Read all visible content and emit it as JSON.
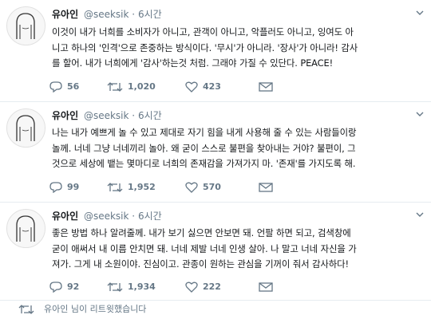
{
  "colors": {
    "text": "#14171a",
    "muted": "#657786",
    "divider": "#e6ecf0"
  },
  "tweets": [
    {
      "name": "유아인",
      "handle": "@seeksik",
      "dot": "·",
      "time": "6시간",
      "lines": [
        "이것이 내가 너희를 소비자가 아니고, 관객이 아니고, 악플러도 아니고, 잉여도 아",
        "니고 하나의 '인격'으로 존중하는 방식이다. '무시'가 아니라. '장사'가 아니라! 감사",
        "를 할어. 내가 너희에게 '감사'하는것 처럼. 그래야 가질 수 있단다. PEACE!"
      ],
      "replies": "56",
      "retweets": "1,020",
      "likes": "423"
    },
    {
      "name": "유아인",
      "handle": "@seeksik",
      "dot": "·",
      "time": "6시간",
      "lines": [
        "나는 내가 예쁘게 놀 수 있고 제대로 자기 힘을 내게 사용해 줄 수 있는 사람들이랑",
        "놀께. 너네 그냥 너네끼리 놀아. 왜 굳이 스스로 불편을 찾아내는 거야? 불편이, 그",
        "것으로 세상에 뱉는 몇마디로 너희의 존재감을 가져가지 마. '존재'를 가지도록 해."
      ],
      "replies": "99",
      "retweets": "1,952",
      "likes": "570"
    },
    {
      "name": "유아인",
      "handle": "@seeksik",
      "dot": "·",
      "time": "6시간",
      "lines": [
        "좋은 방법 하나 알려줄께. 내가 보기 싫으면 안보면 돼. 언팔 하면 되고, 검색창에",
        "굳이 애써서 내 이름 안치면 돼. 너네 제발 너네 인생 살아. 나 말고 너네 자신을 가",
        "져가. 그게 내 소원이야. 진심이고. 관종이 원하는 관심을 기꺼이 줘서 감사하다!"
      ],
      "replies": "92",
      "retweets": "1,934",
      "likes": "222"
    }
  ],
  "retweet_notice": "유아인 님이 리트윗했습니다"
}
